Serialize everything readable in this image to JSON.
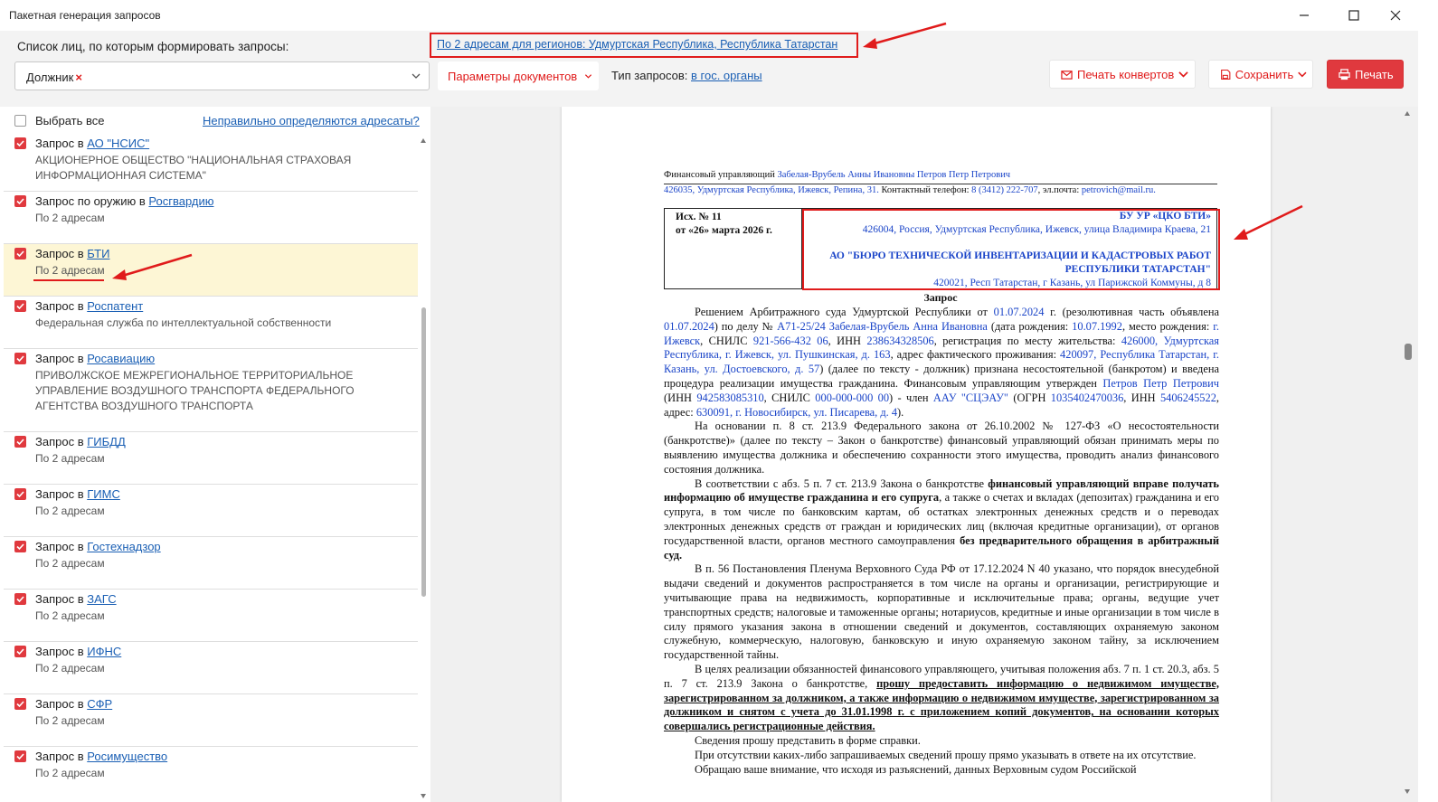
{
  "window": {
    "title": "Пакетная генерация запросов"
  },
  "toolbar": {
    "persons_label": "Список лиц, по которым формировать запросы:",
    "address_link": "По 2 адресам для регионов: Удмуртская Республика, Республика Татарстан",
    "selected_person": "Должник",
    "doc_params": "Параметры документов",
    "request_type_label": "Тип запросов:",
    "request_type_value": "в гос. органы",
    "print_envelopes": "Печать конвертов",
    "save": "Сохранить",
    "print": "Печать"
  },
  "left_panel": {
    "select_all": "Выбрать все",
    "wrong_addresses_link": "Неправильно определяются адресаты?",
    "items": [
      {
        "prefix": "Запрос в",
        "target": "АО \"НСИС\"",
        "sub": "АКЦИОНЕРНОЕ ОБЩЕСТВО \"НАЦИОНАЛЬНАЯ СТРАХОВАЯ ИНФОРМАЦИОННАЯ СИСТЕМА\""
      },
      {
        "prefix": "Запрос по оружию в",
        "target": "Росгвардию",
        "sub": "По 2 адресам"
      },
      {
        "prefix": "Запрос в",
        "target": "БТИ",
        "sub": "По 2 адресам"
      },
      {
        "prefix": "Запрос в",
        "target": "Роспатент",
        "sub": "Федеральная служба по интеллектуальной собственности"
      },
      {
        "prefix": "Запрос в",
        "target": "Росавиацию",
        "sub": "ПРИВОЛЖСКОЕ МЕЖРЕГИОНАЛЬНОЕ ТЕРРИТОРИАЛЬНОЕ УПРАВЛЕНИЕ ВОЗДУШНОГО ТРАНСПОРТА ФЕДЕРАЛЬНОГО АГЕНТСТВА ВОЗДУШНОГО ТРАНСПОРТА"
      },
      {
        "prefix": "Запрос в",
        "target": "ГИБДД",
        "sub": "По 2 адресам"
      },
      {
        "prefix": "Запрос в",
        "target": "ГИМС",
        "sub": "По 2 адресам"
      },
      {
        "prefix": "Запрос в",
        "target": "Гостехнадзор",
        "sub": "По 2 адресам"
      },
      {
        "prefix": "Запрос в",
        "target": "ЗАГС",
        "sub": "По 2 адресам"
      },
      {
        "prefix": "Запрос в",
        "target": "ИФНС",
        "sub": "По 2 адресам"
      },
      {
        "prefix": "Запрос в",
        "target": "СФР",
        "sub": "По 2 адресам"
      },
      {
        "prefix": "Запрос в",
        "target": "Росимущество",
        "sub": "По 2 адресам"
      }
    ]
  },
  "document": {
    "header_line1_label": "Финансовый управляющий",
    "header_line1_value": "Забелая-Врубель Анны Ивановны Петров Петр Петрович",
    "header_line2_addr": "426035, Удмуртская Республика, Ижевск, Репина, 31.",
    "header_line2_phone_label": "Контактный телефон:",
    "header_line2_phone": "8 (3412) 222-707",
    "header_line2_email_label": ", эл.почта:",
    "header_line2_email": "petrovich@mail.ru.",
    "out_number": "Исх. № 11",
    "out_date": "от «26» марта 2026 г.",
    "recipient1_name": "БУ УР «ЦКО БТИ»",
    "recipient1_addr": "426004, Россия, Удмуртская Республика, Ижевск, улица Владимира Краева, 21",
    "recipient2_name": "АО \"БЮРО ТЕХНИЧЕСКОЙ ИНВЕНТАРИЗАЦИИ И КАДАСТРОВЫХ РАБОТ РЕСПУБЛИКИ ТАТАРСТАН\"",
    "recipient2_addr": "420021, Респ Татарстан, г Казань, ул Парижской Коммуны, д 8",
    "heading": "Запрос",
    "p1_a": "Решением Арбитражного суда Удмуртской Республики от ",
    "p1_date1": "01.07.2024",
    "p1_b": " г. (резолютивная часть объявлена ",
    "p1_date2": "01.07.2024",
    "p1_c": ") по делу № ",
    "p1_case": "А71-25/24 Забелая-Врубель Анна Ивановна",
    "p1_d": " (дата рождения: ",
    "p1_birth": "10.07.1992",
    "p1_e": ", место рождения: ",
    "p1_place": "г. Ижевск",
    "p1_f": ", СНИЛС ",
    "p1_snils": "921-566-432 06",
    "p1_g": ", ИНН ",
    "p1_inn": "238634328506",
    "p1_h": ", регистрация по месту жительства: ",
    "p1_reg": "426000, Удмуртская Республика, г. Ижевск, ул. Пушкинская, д. 163",
    "p1_i": ", адрес фактического проживания: ",
    "p1_fact": "420097, Республика Татарстан, г. Казань, ул. Достоевского, д. 57",
    "p1_j": ") (далее по тексту - должник) признана несостоятельной (банкротом) и введена процедура реализации имущества гражданина. Финансовым управляющим утвержден ",
    "p1_fu": "Петров Петр Петрович",
    "p1_k": " (ИНН ",
    "p1_fuinn": "942583085310",
    "p1_l": ", СНИЛС ",
    "p1_fusnils": "000-000-000 00",
    "p1_m": ") - член ",
    "p1_sro": "ААУ \"СЦЭАУ\"",
    "p1_n": " (ОГРН ",
    "p1_ogrn": "1035402470036",
    "p1_o": ", ИНН ",
    "p1_sroinn": "5406245522",
    "p1_p": ", адрес: ",
    "p1_sroaddr": "630091, г. Новосибирск, ул. Писарева, д. 4",
    "p1_q": ").",
    "p2": "На основании п. 8 ст. 213.9 Федерального закона от 26.10.2002 № 127-ФЗ «О несостоятельности (банкротстве)» (далее по тексту – Закон о банкротстве) финансовый управляющий обязан принимать меры по выявлению имущества должника и обеспечению сохранности этого имущества, проводить анализ финансового состояния должника.",
    "p3_a": "В соответствии с абз. 5 п. 7 ст. 213.9 Закона о банкротстве ",
    "p3_bold1": "финансовый управляющий вправе получать информацию об имуществе гражданина и его супруга",
    "p3_b": ", а также о счетах и вкладах (депозитах) гражданина и его супруга, в том числе по банковским картам, об остатках электронных денежных средств и о переводах электронных денежных средств от граждан и юридических лиц (включая кредитные организации), от органов государственной власти, органов местного самоуправления ",
    "p3_bold2": "без предварительного обращения в арбитражный суд.",
    "p4": "В п. 56 Постановления Пленума Верховного Суда РФ от 17.12.2024 N 40 указано, что порядок внесудебной выдачи сведений и документов распространяется в том числе на органы и организации, регистрирующие и учитывающие права на недвижимость, корпоративные и исключительные права; органы, ведущие учет транспортных средств; налоговые и таможенные органы; нотариусов, кредитные и иные организации в том числе в силу прямого указания закона в отношении сведений и документов, составляющих охраняемую законом служебную, коммерческую, налоговую, банковскую и иную охраняемую законом тайну, за исключением государственной тайны.",
    "p5_a": "В целях реализации обязанностей финансового управляющего, учитывая положения абз. 7 п. 1 ст. 20.3, абз. 5 п. 7 ст. 213.9 Закона о банкротстве, ",
    "p5_bold": "прошу предоставить информацию о недвижимом имуществе, зарегистрированном за должником, а также информацию о недвижимом имуществе, зарегистрированном за должником и снятом с учета до 31.01.1998 г. с приложением копий документов, на основании которых совершались регистрационные действия.",
    "p6": "Сведения прошу представить в форме справки.",
    "p7": "При отсутствии каких-либо запрашиваемых сведений прошу прямо указывать в ответе на их отсутствие.",
    "p8": "Обращаю ваше внимание, что исходя из разъяснений, данных Верховным судом Российской"
  },
  "colors": {
    "accent_red": "#e0393e",
    "link_blue": "#1a5fb4",
    "doc_blue": "#1a44c8",
    "highlight_row": "#fdf6d5",
    "annotation_red": "#e01b1b"
  }
}
